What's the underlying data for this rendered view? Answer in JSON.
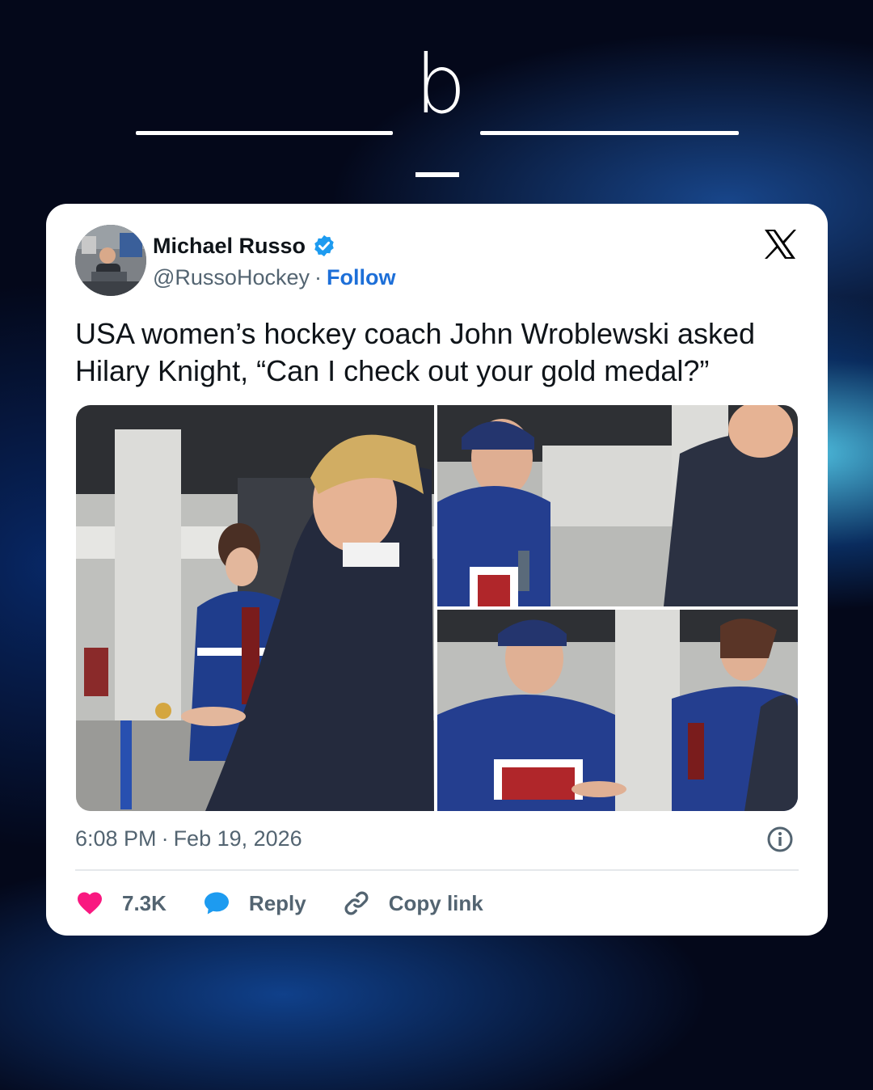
{
  "brand": {
    "logo_letter": "b"
  },
  "tweet": {
    "author": {
      "name": "Michael Russo",
      "handle": "@RussoHockey",
      "verified": true
    },
    "follow_label": "Follow",
    "separator": "·",
    "text": "USA women’s hockey coach John Wroblewski asked Hilary Knight, “Can I check out your gold medal?”",
    "timestamp": {
      "time": "6:08 PM",
      "date": "Feb 19, 2026"
    },
    "actions": {
      "likes": "7.3K",
      "reply_label": "Reply",
      "copy_label": "Copy link"
    }
  },
  "icons": {
    "platform": "x-logo-icon",
    "verified": "verified-badge-icon",
    "info": "info-icon",
    "like": "heart-icon",
    "reply": "speech-bubble-icon",
    "copy": "link-icon"
  },
  "colors": {
    "follow": "#1d6fd8",
    "verified": "#1d9bf0",
    "heart": "#f91880",
    "reply_bubble": "#1d9bf0",
    "muted_text": "#536471"
  }
}
